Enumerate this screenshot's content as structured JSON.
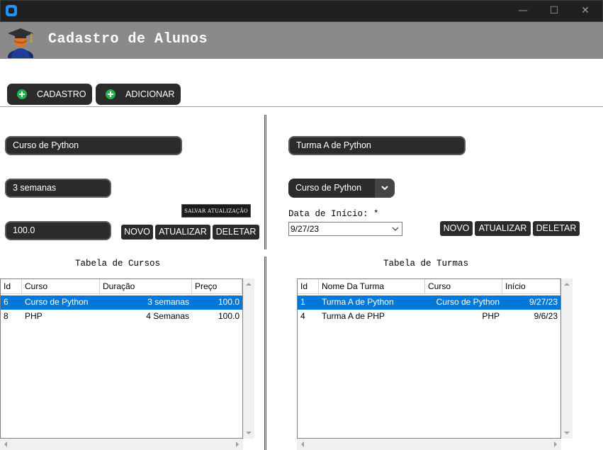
{
  "window": {
    "minimize": "—",
    "maximize": "☐",
    "close": "✕"
  },
  "header": {
    "title": "Cadastro de Alunos",
    "icon": "graduate-student-icon"
  },
  "toolbar": {
    "cadastro_label": "CADASTRO",
    "adicionar_label": "ADICIONAR"
  },
  "cursos_form": {
    "nome_value": "Curso de Python",
    "duracao_value": "3 semanas",
    "preco_value": "100.0",
    "salvar_label": "SALVAR ATUALIZAÇÃO",
    "novo_label": "NOVO",
    "atualizar_label": "ATUALIZAR",
    "deletar_label": "DELETAR"
  },
  "turmas_form": {
    "nome_value": "Turma A de Python",
    "curso_selected": "Curso de Python",
    "data_label": "Data de Início: *",
    "data_value": "9/27/23",
    "novo_label": "NOVO",
    "atualizar_label": "ATUALIZAR",
    "deletar_label": "DELETAR"
  },
  "cursos_table": {
    "title": "Tabela de Cursos",
    "headers": [
      "Id",
      "Curso",
      "Duração",
      "Preço"
    ],
    "rows": [
      {
        "id": "6",
        "curso": "Curso de Python",
        "duracao": "3 semanas",
        "preco": "100.0",
        "selected": true
      },
      {
        "id": "8",
        "curso": "PHP",
        "duracao": "4 Semanas",
        "preco": "100.0",
        "selected": false
      }
    ]
  },
  "turmas_table": {
    "title": "Tabela de Turmas",
    "headers": [
      "Id",
      "Nome Da Turma",
      "Curso",
      "Início"
    ],
    "rows": [
      {
        "id": "1",
        "nome": "Turma A de Python",
        "curso": "Curso de Python",
        "inicio": "9/27/23",
        "selected": true
      },
      {
        "id": "4",
        "nome": "Turma A de PHP",
        "curso": "PHP",
        "inicio": "9/6/23",
        "selected": false
      }
    ]
  },
  "colors": {
    "accent": "#0078d7",
    "header_bg": "#8a8a8a",
    "button_bg": "#2b2b2b",
    "plus_icon": "#22b14c"
  }
}
